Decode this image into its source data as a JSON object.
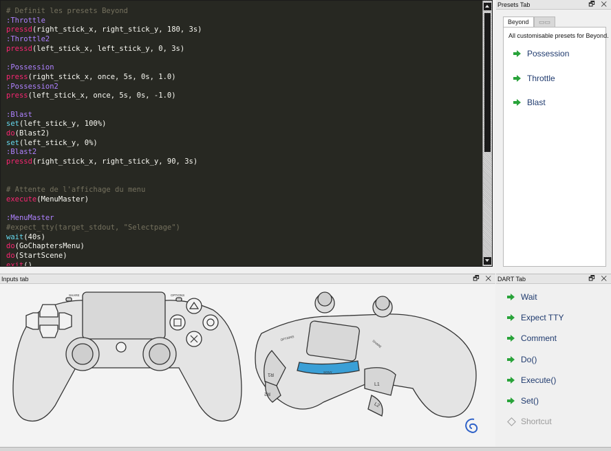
{
  "editor": {
    "lines": [
      {
        "segments": [
          {
            "t": "# Definit les presets Beyond",
            "c": "#75715e"
          }
        ]
      },
      {
        "segments": [
          {
            "t": ":Throttle",
            "c": "#ae81ff"
          }
        ]
      },
      {
        "segments": [
          {
            "t": "pressd",
            "c": "#f92672"
          },
          {
            "t": "(right_stick_x, right_stick_y, 180, 3s)",
            "c": "#f8f8f2"
          }
        ]
      },
      {
        "segments": [
          {
            "t": ":Throttle2",
            "c": "#ae81ff"
          }
        ]
      },
      {
        "segments": [
          {
            "t": "pressd",
            "c": "#f92672"
          },
          {
            "t": "(left_stick_x, left_stick_y, 0, 3s)",
            "c": "#f8f8f2"
          }
        ]
      },
      {
        "segments": [
          {
            "t": "",
            "c": "#f8f8f2"
          }
        ]
      },
      {
        "segments": [
          {
            "t": ":Possession",
            "c": "#ae81ff"
          }
        ]
      },
      {
        "segments": [
          {
            "t": "press",
            "c": "#f92672"
          },
          {
            "t": "(right_stick_x, once, 5s, 0s, 1.0)",
            "c": "#f8f8f2"
          }
        ]
      },
      {
        "segments": [
          {
            "t": ":Possession2",
            "c": "#ae81ff"
          }
        ]
      },
      {
        "segments": [
          {
            "t": "press",
            "c": "#f92672"
          },
          {
            "t": "(left_stick_x, once, 5s, 0s, -1.0)",
            "c": "#f8f8f2"
          }
        ]
      },
      {
        "segments": [
          {
            "t": "",
            "c": "#f8f8f2"
          }
        ]
      },
      {
        "segments": [
          {
            "t": ":Blast",
            "c": "#ae81ff"
          }
        ]
      },
      {
        "segments": [
          {
            "t": "set",
            "c": "#66d9ef"
          },
          {
            "t": "(left_stick_y, 100%)",
            "c": "#f8f8f2"
          }
        ]
      },
      {
        "segments": [
          {
            "t": "do",
            "c": "#f92672"
          },
          {
            "t": "(Blast2)",
            "c": "#f8f8f2"
          }
        ]
      },
      {
        "segments": [
          {
            "t": "set",
            "c": "#66d9ef"
          },
          {
            "t": "(left_stick_y, 0%)",
            "c": "#f8f8f2"
          }
        ]
      },
      {
        "segments": [
          {
            "t": ":Blast2",
            "c": "#ae81ff"
          }
        ]
      },
      {
        "segments": [
          {
            "t": "pressd",
            "c": "#f92672"
          },
          {
            "t": "(right_stick_x, right_stick_y, 90, 3s)",
            "c": "#f8f8f2"
          }
        ]
      },
      {
        "segments": [
          {
            "t": "",
            "c": "#f8f8f2"
          }
        ]
      },
      {
        "segments": [
          {
            "t": "",
            "c": "#f8f8f2"
          }
        ]
      },
      {
        "segments": [
          {
            "t": "# Attente de l'affichage du menu",
            "c": "#75715e"
          }
        ]
      },
      {
        "segments": [
          {
            "t": "execute",
            "c": "#f92672"
          },
          {
            "t": "(MenuMaster)",
            "c": "#f8f8f2"
          }
        ]
      },
      {
        "segments": [
          {
            "t": "",
            "c": "#f8f8f2"
          }
        ]
      },
      {
        "segments": [
          {
            "t": ":MenuMaster",
            "c": "#ae81ff"
          }
        ]
      },
      {
        "segments": [
          {
            "t": "#expect_tty(target_stdout, \"Selectpage\")",
            "c": "#75715e"
          }
        ]
      },
      {
        "segments": [
          {
            "t": "wait",
            "c": "#66d9ef"
          },
          {
            "t": "(40s)",
            "c": "#f8f8f2"
          }
        ]
      },
      {
        "segments": [
          {
            "t": "do",
            "c": "#f92672"
          },
          {
            "t": "(GoChaptersMenu)",
            "c": "#f8f8f2"
          }
        ]
      },
      {
        "segments": [
          {
            "t": "do",
            "c": "#f92672"
          },
          {
            "t": "(StartScene)",
            "c": "#f8f8f2"
          }
        ]
      },
      {
        "segments": [
          {
            "t": "exit",
            "c": "#f92672"
          },
          {
            "t": "()",
            "c": "#f8f8f2"
          }
        ]
      }
    ]
  },
  "presets_panel": {
    "title": "Presets Tab",
    "controls": "🗗 ✕",
    "tabs": [
      "Beyond",
      "▭▭"
    ],
    "description": "All customisable presets for Beyond.",
    "items": [
      "Possession",
      "Throttle",
      "Blast"
    ]
  },
  "inputs_panel": {
    "title": "Inputs tab",
    "controls": "🗗 ✕",
    "controller_labels": {
      "share": "SHARE",
      "options": "OPTIONS",
      "r1": "R1",
      "r2": "R2",
      "l1": "L1",
      "l2": "L2",
      "options_side": "OPTIONS",
      "share_side": "SHARE",
      "sony": "SONY"
    }
  },
  "dart_panel": {
    "title": "DART Tab",
    "controls": "🗗 ✕",
    "items": [
      {
        "label": "Wait",
        "enabled": true
      },
      {
        "label": "Expect TTY",
        "enabled": true
      },
      {
        "label": "Comment",
        "enabled": true
      },
      {
        "label": "Do()",
        "enabled": true
      },
      {
        "label": "Execute()",
        "enabled": true
      },
      {
        "label": "Set()",
        "enabled": true
      },
      {
        "label": "Shortcut",
        "enabled": false
      }
    ]
  },
  "colors": {
    "editor_bg": "#272822",
    "accent_green": "#29a33a",
    "link_blue": "#1f3a6e",
    "touchpad_blue": "#3a9fd6"
  }
}
